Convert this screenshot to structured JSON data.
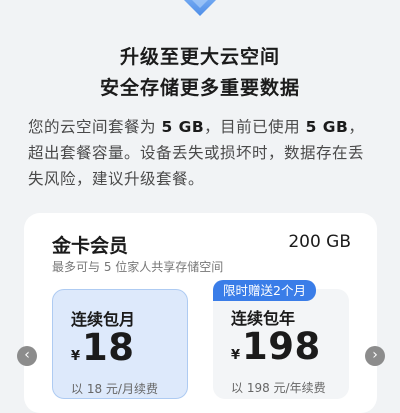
{
  "hero": {
    "icon": "cloud-storage-icon",
    "title_line1": "升级至更大云空间",
    "title_line2": "安全存储更多重要数据"
  },
  "description": {
    "part1": "您的云空间套餐为 ",
    "quota": "5 GB",
    "part2": "，目前已使用 ",
    "used": "5 GB",
    "part3": "，超出套餐容量。设备丢失或损坏时，数据存在丢失风险，建议升级套餐。"
  },
  "tier": {
    "name": "金卡会员",
    "capacity": "200 GB",
    "subtitle": "最多可与 5 位家人共享存储空间"
  },
  "plans": [
    {
      "title": "连续包月",
      "currency": "¥",
      "price": "18",
      "renew_text": "以 18 元/月续费",
      "selected": true
    },
    {
      "title": "连续包年",
      "currency": "¥",
      "price": "198",
      "renew_text": "以 198 元/年续费",
      "badge": "限时赠送2个月",
      "selected": false
    }
  ],
  "nav": {
    "prev_glyph": "‹",
    "next_glyph": "›"
  },
  "colors": {
    "accent": "#3a7de8",
    "selected_bg": "#dde9fb",
    "page_bg": "#f1f3f5"
  }
}
